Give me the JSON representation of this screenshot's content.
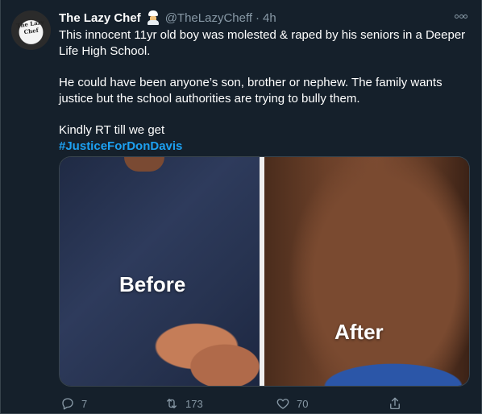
{
  "tweet": {
    "author": {
      "name": "The Lazy Chef",
      "handle": "@TheLazyCheff",
      "separator": "·",
      "time": "4h",
      "avatar_text": "The Lazy Chef",
      "badge_icon": "chef-emoji-icon"
    },
    "text": {
      "line1": "This innocent 11yr old boy was molested & raped by his seniors in a Deeper Life High School.",
      "line2": "He could have been anyone’s son, brother or nephew. The family wants justice but the school authorities are trying to bully them.",
      "line3": "Kindly RT till we get",
      "hashtag": "#JusticeForDonDavis"
    },
    "media": {
      "left_label": "Before",
      "right_label": "After"
    },
    "actions": {
      "reply_count": "7",
      "retweet_count": "173",
      "like_count": "70"
    }
  },
  "colors": {
    "background": "#15202b",
    "secondary_text": "#8899a6",
    "hashtag": "#1da1f2",
    "border": "#38444d"
  }
}
